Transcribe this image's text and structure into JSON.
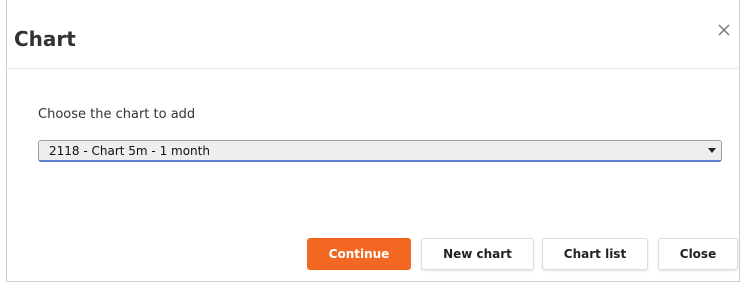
{
  "dialog": {
    "title": "Chart",
    "close_icon": "close-icon"
  },
  "form": {
    "prompt": "Choose the chart to add",
    "chart_select": {
      "selected_value": "2118 - Chart 5m - 1 month",
      "arrow_icon": "dropdown-arrow-icon"
    }
  },
  "buttons": {
    "continue_label": "Continue",
    "new_chart_label": "New chart",
    "chart_list_label": "Chart list",
    "close_label": "Close"
  },
  "colors": {
    "accent": "#f26722",
    "select_focus_border": "#5f7fd0",
    "select_background": "#eeeeee"
  }
}
